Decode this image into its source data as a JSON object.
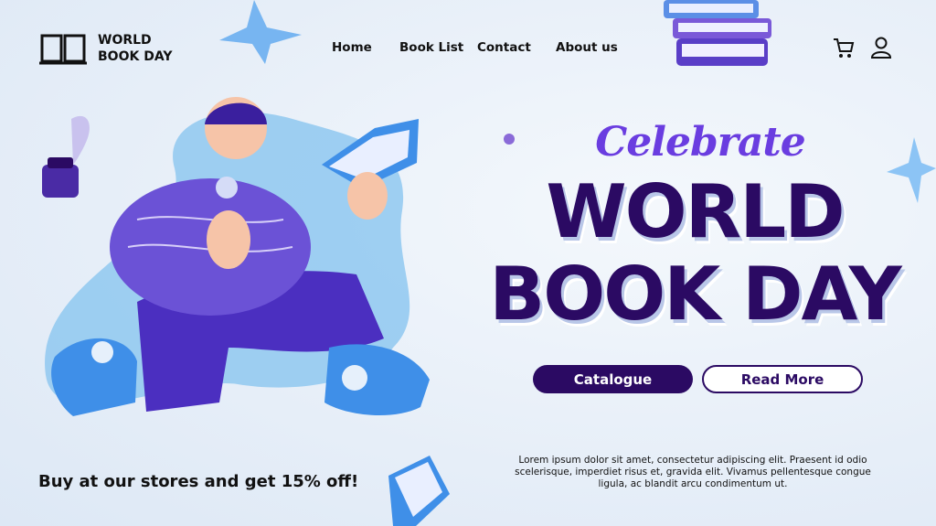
{
  "header": {
    "logo_line1": "WORLD",
    "logo_line2": "BOOK DAY",
    "nav": [
      {
        "label": "Home"
      },
      {
        "label": "Book List"
      },
      {
        "label": "Contact"
      },
      {
        "label": "About us"
      }
    ],
    "cart_icon": "cart-icon",
    "user_icon": "user-icon"
  },
  "hero": {
    "eyebrow": "Celebrate",
    "title_line1": "WORLD",
    "title_line2": "BOOK DAY",
    "primary_button": "Catalogue",
    "secondary_button": "Read More",
    "description": "Lorem ipsum dolor sit amet, consectetur adipiscing elit. Praesent id odio scelerisque, imperdiet risus et, gravida elit. Vivamus pellentesque congue ligula, ac blandit arcu condimentum ut.",
    "promo": "Buy at our stores and get 15% off!"
  },
  "colors": {
    "accent": "#6a3de0",
    "dark": "#2b0a63",
    "blue": "#3f8fe8",
    "background": "#e6eef8"
  }
}
